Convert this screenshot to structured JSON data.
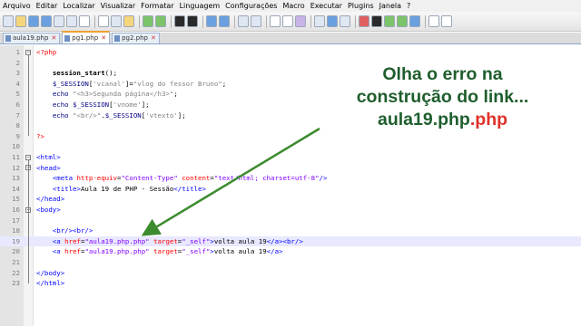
{
  "menu": [
    "Arquivo",
    "Editar",
    "Localizar",
    "Visualizar",
    "Formatar",
    "Linguagem",
    "Configurações",
    "Macro",
    "Executar",
    "Plugins",
    "Janela",
    "?"
  ],
  "tabs": [
    {
      "label": "aula19.php",
      "active": false
    },
    {
      "label": "pg1.php",
      "active": true
    },
    {
      "label": "pg2.php",
      "active": false
    }
  ],
  "code_lines": [
    {
      "n": "1",
      "html": "<span class=\"php\">&lt;?php</span>"
    },
    {
      "n": "2",
      "html": ""
    },
    {
      "n": "3",
      "html": "    <span class=\"f\">session_start</span>();"
    },
    {
      "n": "4",
      "html": "    <span class=\"v\">$_SESSION</span>[<span class=\"s\">'vcanal'</span>]=<span class=\"s\">\"vlog do fessor Bruno\"</span>;"
    },
    {
      "n": "5",
      "html": "    <span class=\"k\">echo</span> <span class=\"s\">\"&lt;h3&gt;Segunda página&lt;/h3&gt;\"</span>;"
    },
    {
      "n": "6",
      "html": "    <span class=\"k\">echo</span> <span class=\"v\">$_SESSION</span>[<span class=\"s\">'vnome'</span>];"
    },
    {
      "n": "7",
      "html": "    <span class=\"k\">echo</span> <span class=\"s\">\"&lt;br/&gt;\"</span>.<span class=\"v\">$_SESSION</span>[<span class=\"s\">'vtexto'</span>];"
    },
    {
      "n": "8",
      "html": ""
    },
    {
      "n": "9",
      "html": "<span class=\"php\">?&gt;</span>"
    },
    {
      "n": "10",
      "html": ""
    },
    {
      "n": "11",
      "html": "<span class=\"t\">&lt;html&gt;</span>"
    },
    {
      "n": "12",
      "html": "<span class=\"t\">&lt;head&gt;</span>"
    },
    {
      "n": "13",
      "html": "    <span class=\"t\">&lt;meta</span> <span class=\"a\">http-equiv</span>=<span class=\"av\">\"Content-Type\"</span> <span class=\"a\">content</span>=<span class=\"av\">\"text/html; charset=utf-8\"</span><span class=\"t\">/&gt;</span>"
    },
    {
      "n": "14",
      "html": "    <span class=\"t\">&lt;title&gt;</span>Aula 19 de PHP - Sessão<span class=\"t\">&lt;/title&gt;</span>"
    },
    {
      "n": "15",
      "html": "<span class=\"t\">&lt;/head&gt;</span>"
    },
    {
      "n": "16",
      "html": "<span class=\"t\">&lt;body&gt;</span>"
    },
    {
      "n": "17",
      "html": ""
    },
    {
      "n": "18",
      "html": "    <span class=\"t\">&lt;br/&gt;&lt;br/&gt;</span>"
    },
    {
      "n": "19",
      "html": "    <span class=\"t\">&lt;a</span> <span class=\"a\">href</span>=<span class=\"av\">\"aula19.php.php\"</span> <span class=\"a\">target</span>=<span class=\"av\">\"_self\"</span><span class=\"t\">&gt;</span>volta aula 19<span class=\"t\">&lt;/a&gt;&lt;br/&gt;</span>"
    },
    {
      "n": "20",
      "html": "    <span class=\"t\">&lt;a</span> <span class=\"a\">href</span>=<span class=\"av\">\"aula19.php.php\"</span> <span class=\"a\">target</span>=<span class=\"av\">\"_self\"</span><span class=\"t\">&gt;</span>volta aula 19<span class=\"t\">&lt;/a&gt;</span>"
    },
    {
      "n": "21",
      "html": ""
    },
    {
      "n": "22",
      "html": "<span class=\"t\">&lt;/body&gt;</span>"
    },
    {
      "n": "23",
      "html": "<span class=\"t\">&lt;/html&gt;</span>"
    }
  ],
  "annotation": {
    "line1": "Olha o erro na",
    "line2": "construção do link...",
    "line3_black": "aula19.php",
    "line3_red": ".php"
  },
  "colors": {
    "annotation": "#1f5e2d",
    "highlight": "#e0302a",
    "arrow": "#3d8b2f"
  }
}
